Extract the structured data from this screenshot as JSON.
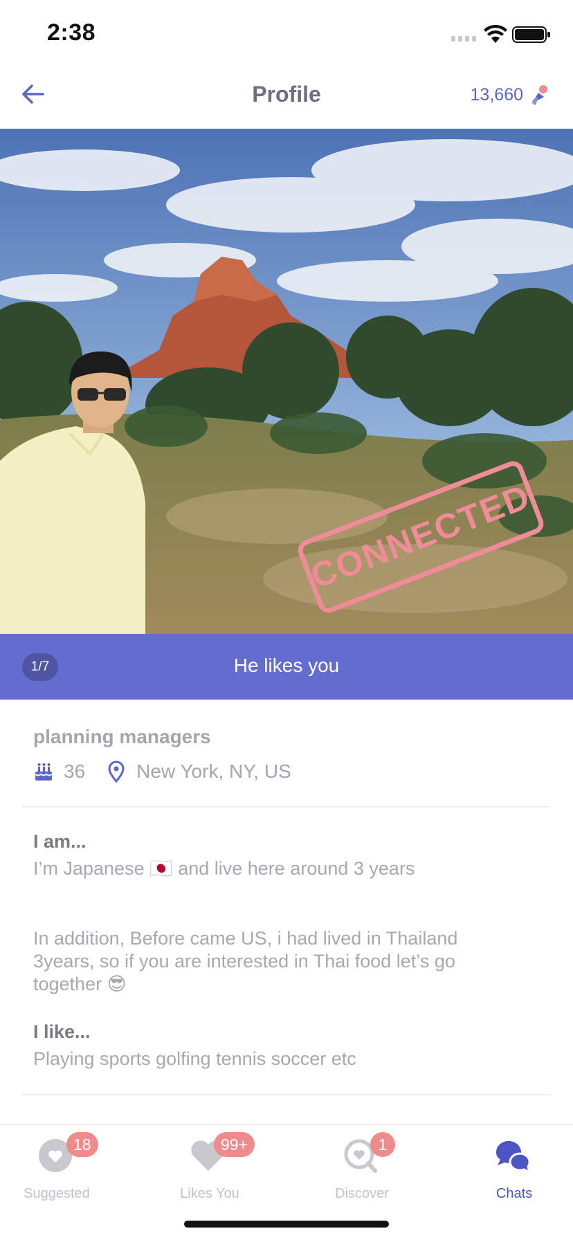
{
  "status_bar": {
    "time": "2:38"
  },
  "header": {
    "title": "Profile",
    "coins": "13,660"
  },
  "photo": {
    "page_counter": "1/7",
    "stamp": "CONNECTED",
    "banner": "He likes you"
  },
  "profile": {
    "job": "planning managers",
    "age": "36",
    "location": "New York, NY, US",
    "i_am_title": "I am...",
    "i_am_line1": "I’m Japanese 🇯🇵 and live here around 3 years",
    "i_am_line2": "In addition, Before came US, i had lived in Thailand",
    "i_am_line3": "3years, so if you are interested in Thai food let’s go",
    "i_am_line4": "together 😎",
    "i_like_title": "I like...",
    "i_like_text": "Playing sports golfing tennis soccer etc"
  },
  "tabs": [
    {
      "label": "Suggested",
      "badge": "18",
      "icon": "heart-bubble-icon"
    },
    {
      "label": "Likes You",
      "badge": "99+",
      "icon": "heart-icon"
    },
    {
      "label": "Discover",
      "badge": "1",
      "icon": "search-heart-icon"
    },
    {
      "label": "Chats",
      "badge": "",
      "icon": "chat-bubbles-icon"
    }
  ],
  "colors": {
    "accent": "#646dcf",
    "badge": "#f08b8b",
    "stamp": "#f08b98"
  }
}
